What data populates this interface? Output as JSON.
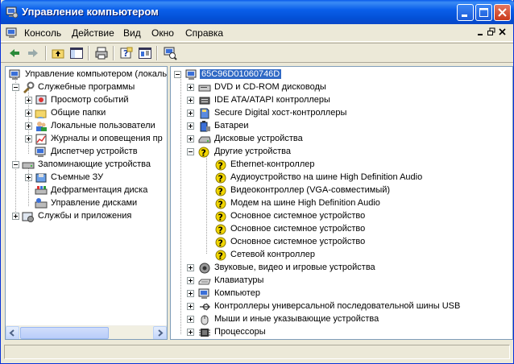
{
  "window": {
    "title": "Управление компьютером"
  },
  "menu": {
    "items": [
      "Консоль",
      "Действие",
      "Вид",
      "Окно",
      "Справка"
    ]
  },
  "toolbar": {
    "buttons": [
      "back-icon",
      "forward-icon",
      "up-folder-icon",
      "show-hide-tree-icon",
      "print-icon",
      "help-icon",
      "properties-icon",
      "scan-hardware-icon"
    ]
  },
  "left_tree": {
    "root": "Управление компьютером (локаль",
    "system_tools": "Служебные программы",
    "event_viewer": "Просмотр событий",
    "shared_folders": "Общие папки",
    "local_users": "Локальные пользователи",
    "perf_logs": "Журналы и оповещения пр",
    "device_manager": "Диспетчер устройств",
    "storage": "Запоминающие устройства",
    "removable": "Съемные ЗУ",
    "defrag": "Дефрагментация диска",
    "disk_mgmt": "Управление дисками",
    "services": "Службы и приложения"
  },
  "right_tree": {
    "computer": "65C96D01060746D",
    "dvd": "DVD и CD-ROM дисководы",
    "ide": "IDE ATA/ATAPI контроллеры",
    "sd": "Secure Digital хост-контроллеры",
    "batteries": "Батареи",
    "disks": "Дисковые устройства",
    "other": "Другие устройства",
    "ethernet": "Ethernet-контроллер",
    "audio_hd": "Аудиоустройство на шине High Definition Audio",
    "video": "Видеоконтроллер (VGA-совместимый)",
    "modem": "Модем на шине High Definition Audio",
    "sys1": "Основное системное устройство",
    "sys2": "Основное системное устройство",
    "sys3": "Основное системное устройство",
    "network": "Сетевой контроллер",
    "sound": "Звуковые, видео и игровые устройства",
    "keyboards": "Клавиатуры",
    "computer_cat": "Компьютер",
    "usb": "Контроллеры универсальной последовательной шины USB",
    "mice": "Мыши и иные указывающие устройства",
    "cpus": "Процессоры"
  },
  "colors": {
    "titlebar": "#0a5fea",
    "selection": "#316ac5",
    "warning": "#f2d600"
  }
}
